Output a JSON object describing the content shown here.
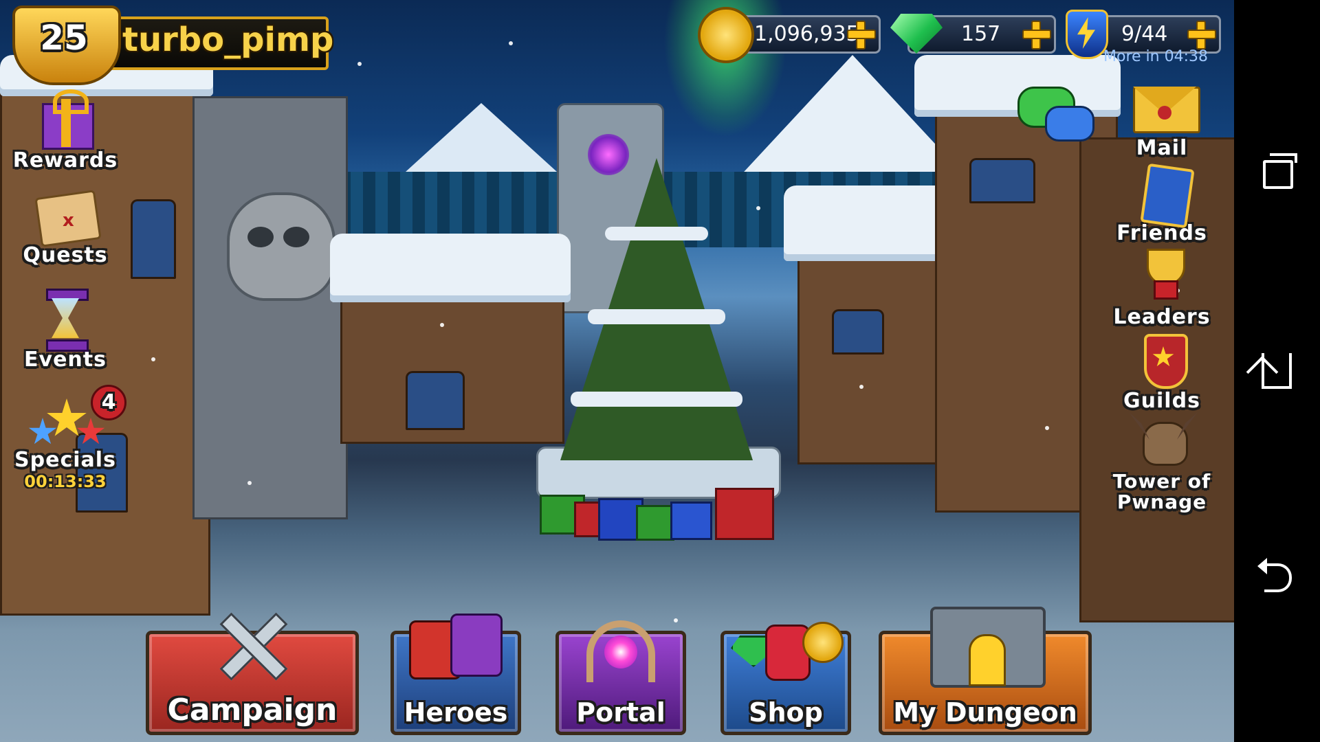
{
  "player": {
    "level": "25",
    "name": "turbo_pimp"
  },
  "resources": {
    "gold": "1,096,935",
    "gems": "157",
    "energy": "9/44",
    "energy_timer": "More in 04:38"
  },
  "left_menu": [
    {
      "id": "rewards",
      "label": "Rewards",
      "icon": "gift-icon"
    },
    {
      "id": "quests",
      "label": "Quests",
      "icon": "treasure-map-icon"
    },
    {
      "id": "events",
      "label": "Events",
      "icon": "hourglass-icon"
    },
    {
      "id": "specials",
      "label": "Specials",
      "icon": "stars-icon",
      "badge": "4",
      "timer": "00:13:33"
    }
  ],
  "right_menu": [
    {
      "id": "mail",
      "label": "Mail",
      "icon": "envelope-icon"
    },
    {
      "id": "friends",
      "label": "Friends",
      "icon": "friends-card-icon"
    },
    {
      "id": "leaders",
      "label": "Leaders",
      "icon": "trophy-icon"
    },
    {
      "id": "guilds",
      "label": "Guilds",
      "icon": "shield-icon"
    },
    {
      "id": "tower",
      "label": "Tower of Pwnage",
      "icon": "dragon-icon"
    }
  ],
  "bottom_menu": [
    {
      "id": "campaign",
      "label": "Campaign",
      "color": "#c23a32"
    },
    {
      "id": "heroes",
      "label": "Heroes",
      "color": "#2f5fa6"
    },
    {
      "id": "portal",
      "label": "Portal",
      "color": "#7a2fa6"
    },
    {
      "id": "shop",
      "label": "Shop",
      "color": "#2f67b0"
    },
    {
      "id": "dungeon",
      "label": "My Dungeon",
      "color": "#d9741e"
    }
  ],
  "colors": {
    "gold": "#ffc21a",
    "gem": "#3ee07a",
    "energy": "#2a6fe0"
  }
}
